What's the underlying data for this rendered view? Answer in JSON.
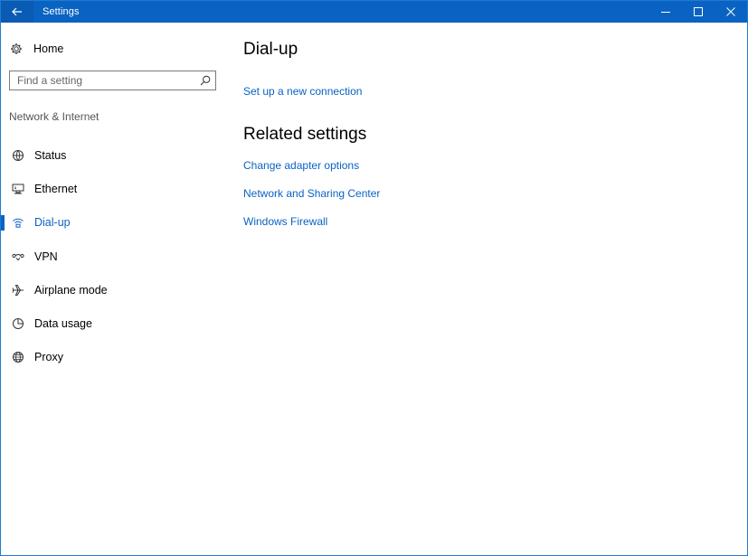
{
  "window": {
    "title": "Settings",
    "icons": {
      "back": "arrow-left-icon",
      "minimize": "minimize-icon",
      "maximize": "maximize-icon",
      "close": "close-icon"
    }
  },
  "sidebar": {
    "home": {
      "label": "Home",
      "icon": "gear-icon"
    },
    "search": {
      "placeholder": "Find a setting",
      "value": "",
      "icon": "search-icon"
    },
    "section_title": "Network & Internet",
    "items": [
      {
        "label": "Status",
        "icon": "globe-status-icon",
        "active": false
      },
      {
        "label": "Ethernet",
        "icon": "ethernet-icon",
        "active": false
      },
      {
        "label": "Dial-up",
        "icon": "dialup-icon",
        "active": true
      },
      {
        "label": "VPN",
        "icon": "vpn-icon",
        "active": false
      },
      {
        "label": "Airplane mode",
        "icon": "airplane-icon",
        "active": false
      },
      {
        "label": "Data usage",
        "icon": "pie-chart-icon",
        "active": false
      },
      {
        "label": "Proxy",
        "icon": "globe-icon",
        "active": false
      }
    ]
  },
  "main": {
    "title": "Dial-up",
    "setup_link": "Set up a new connection",
    "related": {
      "title": "Related settings",
      "links": [
        "Change adapter options",
        "Network and Sharing Center",
        "Windows Firewall"
      ]
    }
  },
  "colors": {
    "accent": "#0a63c2",
    "titlebar": "#0a63c2",
    "text": "#000000",
    "muted": "#555555"
  }
}
